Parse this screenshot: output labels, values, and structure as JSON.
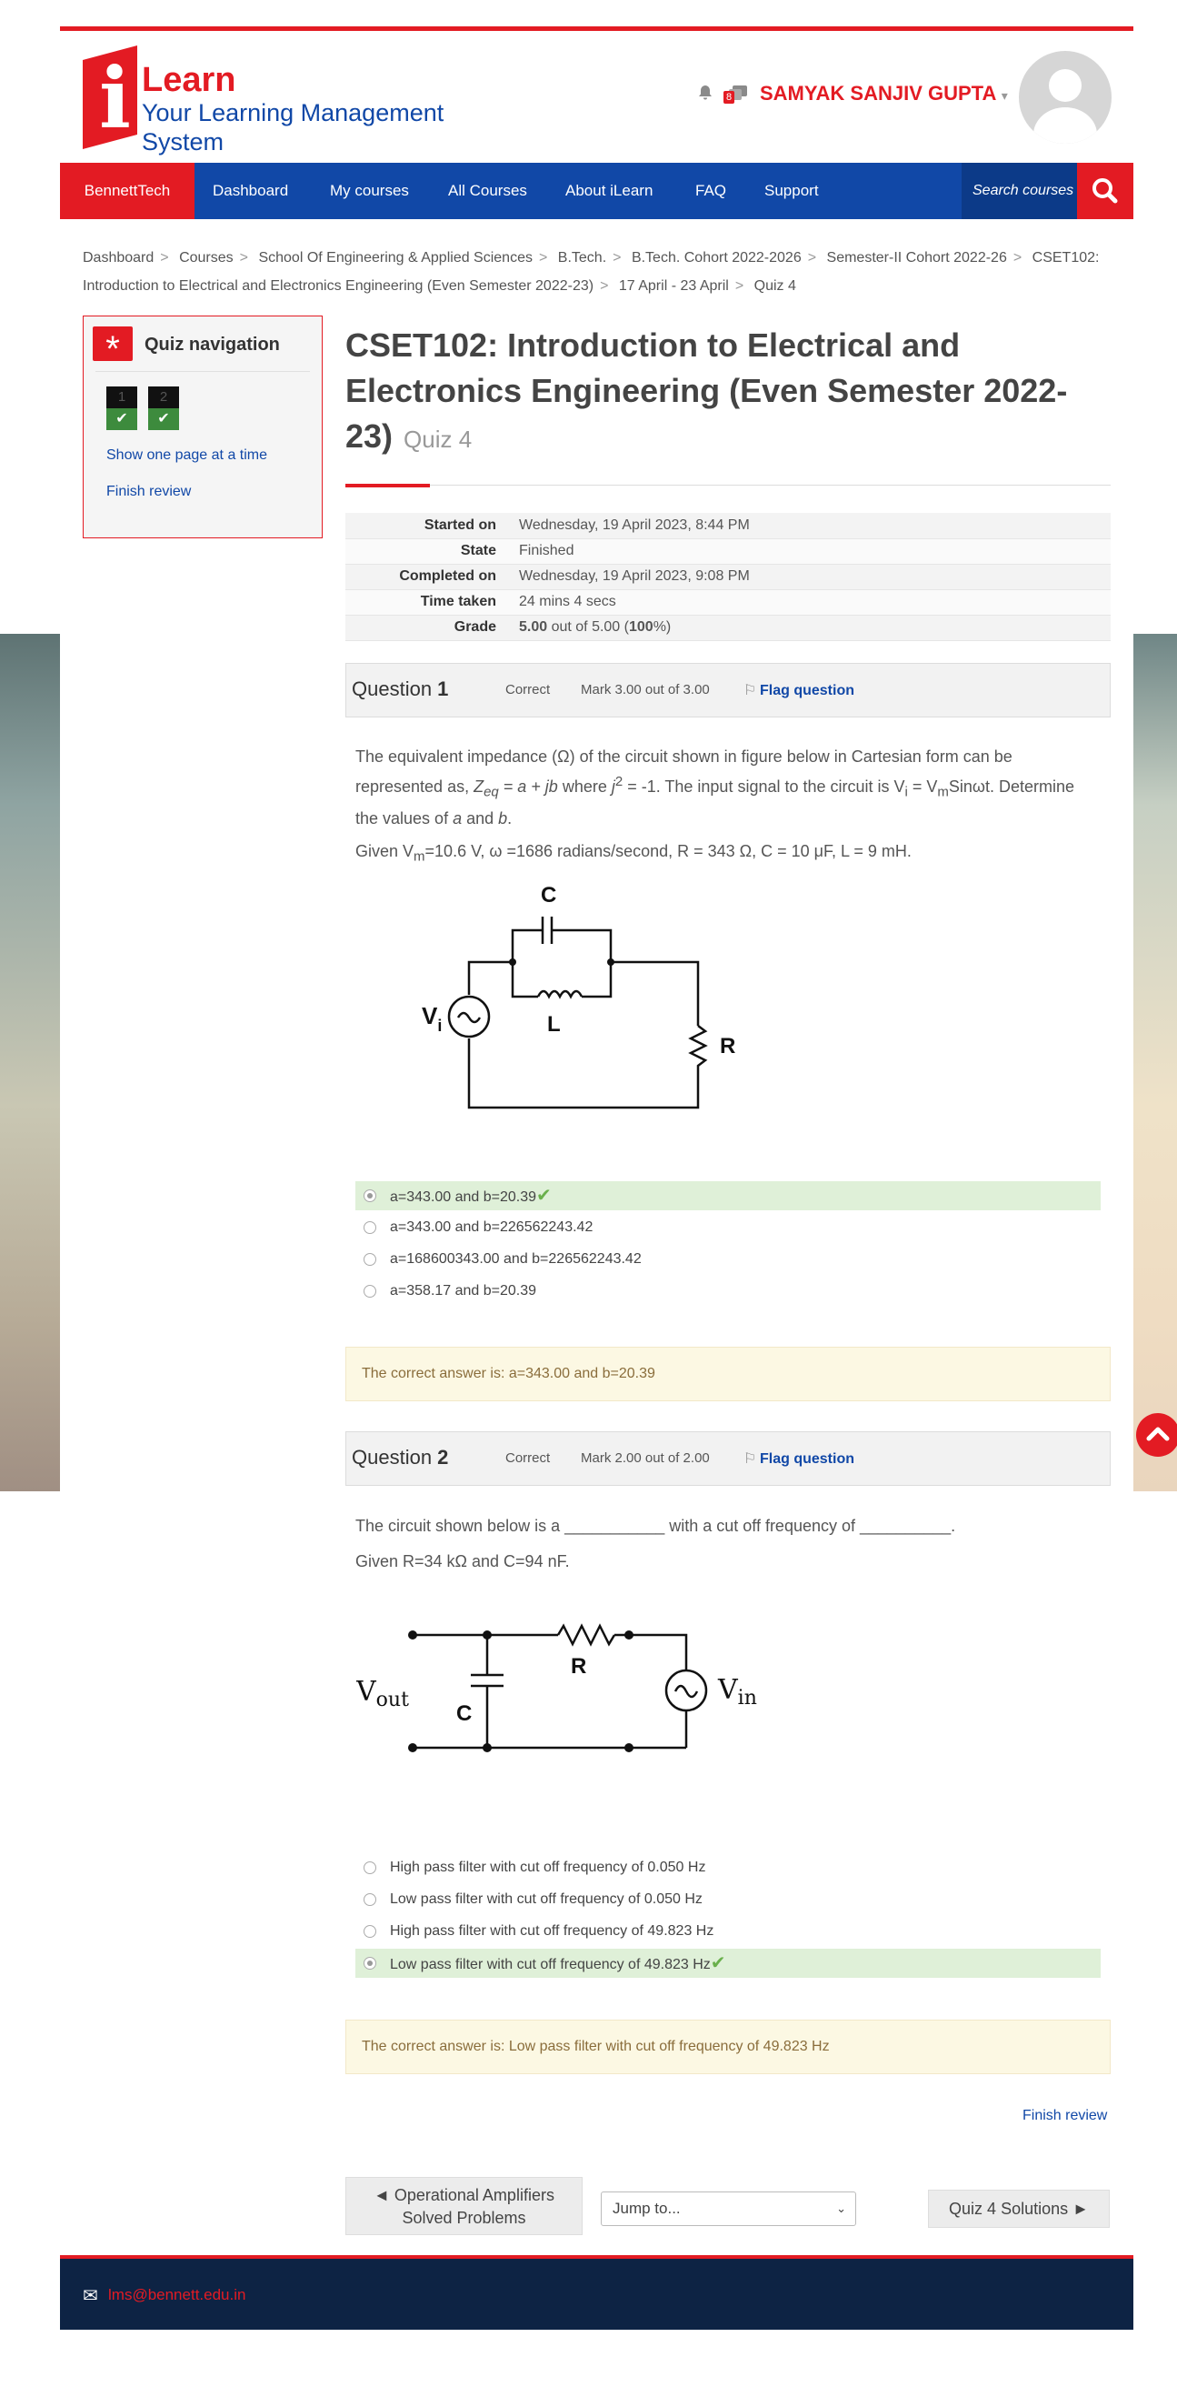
{
  "header": {
    "logo_i": "i",
    "logo_learn": "Learn",
    "logo_tagline": "Your Learning Management System",
    "notification_badge": "8",
    "username": "SAMYAK SANJIV GUPTA",
    "brand_color": "#e31b23",
    "nav_color": "#1148a7"
  },
  "nav": {
    "brand": "BennettTech",
    "items": [
      "Dashboard",
      "My courses",
      "All Courses",
      "About iLearn",
      "FAQ",
      "Support"
    ],
    "search_placeholder": "Search courses"
  },
  "breadcrumb": [
    "Dashboard",
    "Courses",
    "School Of Engineering & Applied Sciences",
    "B.Tech.",
    "B.Tech. Cohort 2022-2026",
    "Semester-II Cohort 2022-26",
    "CSET102: Introduction to Electrical and Electronics Engineering (Even Semester 2022-23)",
    "17 April - 23 April",
    "Quiz 4"
  ],
  "quiz_nav": {
    "title": "Quiz navigation",
    "questions": [
      "1",
      "2"
    ],
    "show_one_page": "Show one page at a time",
    "finish_review": "Finish review"
  },
  "page": {
    "course_title": "CSET102: Introduction to Electrical and Electronics Engineering (Even Semester 2022-23)",
    "quiz_name": "Quiz 4"
  },
  "summary": [
    {
      "label": "Started on",
      "value": "Wednesday, 19 April 2023, 8:44 PM"
    },
    {
      "label": "State",
      "value": "Finished"
    },
    {
      "label": "Completed on",
      "value": "Wednesday, 19 April 2023, 9:08 PM"
    },
    {
      "label": "Time taken",
      "value": "24 mins 4 secs"
    },
    {
      "label": "Grade",
      "value_bold": "5.00",
      "value_rest": " out of 5.00 (",
      "value_pct": "100",
      "value_end": "%)"
    }
  ],
  "q1": {
    "number_label": "Question ",
    "number": "1",
    "state": "Correct",
    "mark": "Mark 3.00 out of 3.00",
    "flag": "Flag question",
    "text_a": "The equivalent impedance (Ω) of the circuit shown in figure below in Cartesian form can be represented as, ",
    "z": "Z",
    "z_sub": "eq",
    "text_b": " = a + jb",
    "text_c": " where ",
    "j": "j",
    "j_sup": "2",
    "text_d": " = -1.  The input signal to the circuit is V",
    "vi_sub": "i",
    "text_e": " = V",
    "vm_sub": "m",
    "text_f": "Sinωt. Determine the values of ",
    "a": "a",
    "and": " and ",
    "b": "b",
    "dot": ".",
    "given_a": "Given V",
    "given_sub": "m",
    "given_b": "=10.6 V, ω =1686 radians/second, R = 343 Ω, C = 10 μF, L = 9 mH.",
    "circuit": {
      "c": "C",
      "l": "L",
      "v": "V",
      "v_sub": "i",
      "r": "R"
    },
    "answers": [
      {
        "text": "a=343.00 and b=20.39",
        "correct": true
      },
      {
        "text": "a=343.00 and b=226562243.42",
        "correct": false
      },
      {
        "text": "a=168600343.00 and b=226562243.42",
        "correct": false
      },
      {
        "text": "a=358.17 and b=20.39",
        "correct": false
      }
    ],
    "right_answer": "The correct answer is: a=343.00 and b=20.39"
  },
  "q2": {
    "number_label": "Question ",
    "number": "2",
    "state": "Correct",
    "mark": "Mark 2.00 out of 2.00",
    "flag": "Flag question",
    "text": "The circuit shown below is a ___________ with a cut off frequency of __________.",
    "given": "Given R=34 kΩ and C=94 nF.",
    "circuit": {
      "vout": "V",
      "vout_sub": "out",
      "r": "R",
      "c": "C",
      "vin": "V",
      "vin_sub": "in"
    },
    "answers": [
      {
        "text": "High pass filter with cut off frequency of 0.050 Hz",
        "correct": false
      },
      {
        "text": "Low pass filter with cut off frequency of 0.050 Hz",
        "correct": false
      },
      {
        "text": "High pass filter with cut off frequency of 49.823 Hz",
        "correct": false
      },
      {
        "text": "Low pass filter with cut off frequency of 49.823 Hz",
        "correct": true
      }
    ],
    "right_answer": "The correct answer is: Low pass filter with cut off frequency of 49.823 Hz"
  },
  "footer_nav": {
    "finish_review": "Finish review",
    "prev_line1": "◄ Operational Amplifiers",
    "prev_line2": "Solved Problems",
    "jump": "Jump to...",
    "next": "Quiz 4 Solutions ►"
  },
  "footer": {
    "email": "lms@bennett.edu.in"
  }
}
